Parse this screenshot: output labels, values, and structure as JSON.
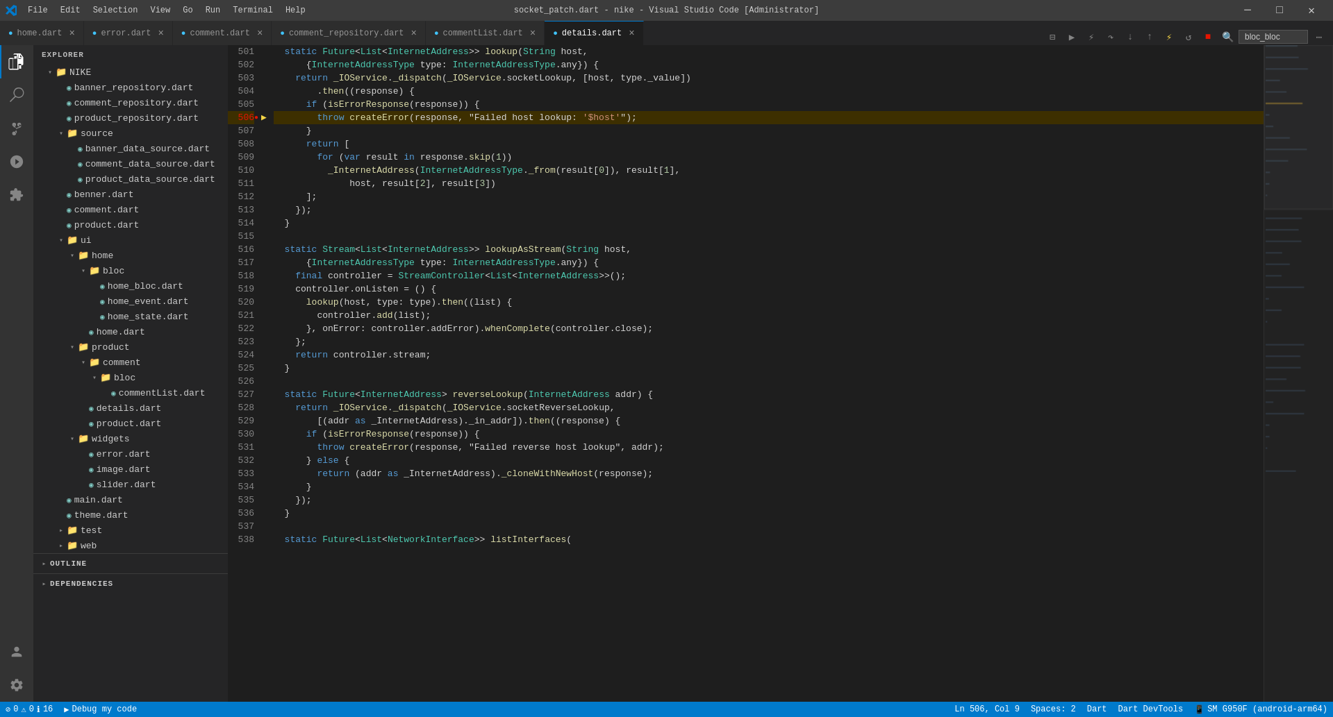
{
  "titlebar": {
    "title": "socket_patch.dart - nike - Visual Studio Code [Administrator]",
    "menu": [
      "File",
      "Edit",
      "Selection",
      "View",
      "Go",
      "Run",
      "Terminal",
      "Help"
    ],
    "controls": [
      "─",
      "□",
      "✕"
    ]
  },
  "tabs": [
    {
      "label": "home.dart",
      "icon": "dart",
      "active": false,
      "dirty": false
    },
    {
      "label": "error.dart",
      "icon": "dart",
      "active": false,
      "dirty": false
    },
    {
      "label": "comment.dart",
      "icon": "dart",
      "active": false,
      "dirty": false
    },
    {
      "label": "comment_repository.dart",
      "icon": "dart",
      "active": false,
      "dirty": false
    },
    {
      "label": "commentList.dart",
      "icon": "dart",
      "active": false,
      "dirty": false
    },
    {
      "label": "details.dart",
      "icon": "dart",
      "active": true,
      "dirty": false
    }
  ],
  "toolbar_search": "bloc_bloc",
  "sidebar": {
    "title": "EXPLORER",
    "tree": [
      {
        "label": "NIKE",
        "indent": 0,
        "type": "folder",
        "open": true
      },
      {
        "label": "banner_repository.dart",
        "indent": 1,
        "type": "file-dart"
      },
      {
        "label": "comment_repository.dart",
        "indent": 1,
        "type": "file-dart"
      },
      {
        "label": "product_repository.dart",
        "indent": 1,
        "type": "file-dart"
      },
      {
        "label": "source",
        "indent": 1,
        "type": "folder",
        "open": true
      },
      {
        "label": "banner_data_source.dart",
        "indent": 2,
        "type": "file-dart"
      },
      {
        "label": "comment_data_source.dart",
        "indent": 2,
        "type": "file-dart"
      },
      {
        "label": "product_data_source.dart",
        "indent": 2,
        "type": "file-dart"
      },
      {
        "label": "benner.dart",
        "indent": 1,
        "type": "file-dart"
      },
      {
        "label": "comment.dart",
        "indent": 1,
        "type": "file-dart"
      },
      {
        "label": "product.dart",
        "indent": 1,
        "type": "file-dart"
      },
      {
        "label": "ui",
        "indent": 1,
        "type": "folder",
        "open": true
      },
      {
        "label": "home",
        "indent": 2,
        "type": "folder",
        "open": true
      },
      {
        "label": "bloc",
        "indent": 3,
        "type": "folder",
        "open": true
      },
      {
        "label": "home_bloc.dart",
        "indent": 4,
        "type": "file-dart"
      },
      {
        "label": "home_event.dart",
        "indent": 4,
        "type": "file-dart"
      },
      {
        "label": "home_state.dart",
        "indent": 4,
        "type": "file-dart"
      },
      {
        "label": "home.dart",
        "indent": 3,
        "type": "file-dart"
      },
      {
        "label": "product",
        "indent": 2,
        "type": "folder",
        "open": true
      },
      {
        "label": "comment",
        "indent": 3,
        "type": "folder",
        "open": true
      },
      {
        "label": "bloc",
        "indent": 4,
        "type": "folder",
        "open": true
      },
      {
        "label": "commentList.dart",
        "indent": 5,
        "type": "file-dart"
      },
      {
        "label": "details.dart",
        "indent": 3,
        "type": "file-dart"
      },
      {
        "label": "product.dart",
        "indent": 3,
        "type": "file-dart"
      },
      {
        "label": "widgets",
        "indent": 2,
        "type": "folder",
        "open": true
      },
      {
        "label": "error.dart",
        "indent": 3,
        "type": "file-dart"
      },
      {
        "label": "image.dart",
        "indent": 3,
        "type": "file-dart"
      },
      {
        "label": "slider.dart",
        "indent": 3,
        "type": "file-dart"
      },
      {
        "label": "main.dart",
        "indent": 1,
        "type": "file-dart"
      },
      {
        "label": "theme.dart",
        "indent": 1,
        "type": "file-dart"
      },
      {
        "label": "test",
        "indent": 1,
        "type": "folder",
        "open": false
      },
      {
        "label": "web",
        "indent": 1,
        "type": "folder",
        "open": false
      }
    ],
    "outline": "OUTLINE",
    "dependencies": "DEPENDENCIES"
  },
  "code": {
    "lines": [
      {
        "num": 501,
        "content": "  static Future<List<InternetAddress>> lookup(String host,",
        "highlighted": false,
        "breakpoint": false
      },
      {
        "num": 502,
        "content": "      {InternetAddressType type: InternetAddressType.any}) {",
        "highlighted": false,
        "breakpoint": false
      },
      {
        "num": 503,
        "content": "    return _IOService._dispatch(_IOService.socketLookup, [host, type._value])",
        "highlighted": false,
        "breakpoint": false
      },
      {
        "num": 504,
        "content": "        .then((response) {",
        "highlighted": false,
        "breakpoint": false
      },
      {
        "num": 505,
        "content": "      if (isErrorResponse(response)) {",
        "highlighted": false,
        "breakpoint": false
      },
      {
        "num": 506,
        "content": "        throw createError(response, \"Failed host lookup: '$host'\");",
        "highlighted": true,
        "breakpoint": true,
        "debug": true
      },
      {
        "num": 507,
        "content": "      }",
        "highlighted": false,
        "breakpoint": false
      },
      {
        "num": 508,
        "content": "      return [",
        "highlighted": false,
        "breakpoint": false
      },
      {
        "num": 509,
        "content": "        for (var result in response.skip(1))",
        "highlighted": false,
        "breakpoint": false
      },
      {
        "num": 510,
        "content": "          _InternetAddress(InternetAddressType._from(result[0]), result[1],",
        "highlighted": false,
        "breakpoint": false
      },
      {
        "num": 511,
        "content": "              host, result[2], result[3])",
        "highlighted": false,
        "breakpoint": false
      },
      {
        "num": 512,
        "content": "      ];",
        "highlighted": false,
        "breakpoint": false
      },
      {
        "num": 513,
        "content": "    });",
        "highlighted": false,
        "breakpoint": false
      },
      {
        "num": 514,
        "content": "  }",
        "highlighted": false,
        "breakpoint": false
      },
      {
        "num": 515,
        "content": "",
        "highlighted": false,
        "breakpoint": false
      },
      {
        "num": 516,
        "content": "  static Stream<List<InternetAddress>> lookupAsStream(String host,",
        "highlighted": false,
        "breakpoint": false
      },
      {
        "num": 517,
        "content": "      {InternetAddressType type: InternetAddressType.any}) {",
        "highlighted": false,
        "breakpoint": false
      },
      {
        "num": 518,
        "content": "    final controller = StreamController<List<InternetAddress>>();",
        "highlighted": false,
        "breakpoint": false
      },
      {
        "num": 519,
        "content": "    controller.onListen = () {",
        "highlighted": false,
        "breakpoint": false
      },
      {
        "num": 520,
        "content": "      lookup(host, type: type).then((list) {",
        "highlighted": false,
        "breakpoint": false
      },
      {
        "num": 521,
        "content": "        controller.add(list);",
        "highlighted": false,
        "breakpoint": false
      },
      {
        "num": 522,
        "content": "      }, onError: controller.addError).whenComplete(controller.close);",
        "highlighted": false,
        "breakpoint": false
      },
      {
        "num": 523,
        "content": "    };",
        "highlighted": false,
        "breakpoint": false
      },
      {
        "num": 524,
        "content": "    return controller.stream;",
        "highlighted": false,
        "breakpoint": false
      },
      {
        "num": 525,
        "content": "  }",
        "highlighted": false,
        "breakpoint": false
      },
      {
        "num": 526,
        "content": "",
        "highlighted": false,
        "breakpoint": false
      },
      {
        "num": 527,
        "content": "  static Future<InternetAddress> reverseLookup(InternetAddress addr) {",
        "highlighted": false,
        "breakpoint": false
      },
      {
        "num": 528,
        "content": "    return _IOService._dispatch(_IOService.socketReverseLookup,",
        "highlighted": false,
        "breakpoint": false
      },
      {
        "num": 529,
        "content": "        [(addr as _InternetAddress)._in_addr]).then((response) {",
        "highlighted": false,
        "breakpoint": false
      },
      {
        "num": 530,
        "content": "      if (isErrorResponse(response)) {",
        "highlighted": false,
        "breakpoint": false
      },
      {
        "num": 531,
        "content": "        throw createError(response, \"Failed reverse host lookup\", addr);",
        "highlighted": false,
        "breakpoint": false
      },
      {
        "num": 532,
        "content": "      } else {",
        "highlighted": false,
        "breakpoint": false
      },
      {
        "num": 533,
        "content": "        return (addr as _InternetAddress)._cloneWithNewHost(response);",
        "highlighted": false,
        "breakpoint": false
      },
      {
        "num": 534,
        "content": "      }",
        "highlighted": false,
        "breakpoint": false
      },
      {
        "num": 535,
        "content": "    });",
        "highlighted": false,
        "breakpoint": false
      },
      {
        "num": 536,
        "content": "  }",
        "highlighted": false,
        "breakpoint": false
      },
      {
        "num": 537,
        "content": "",
        "highlighted": false,
        "breakpoint": false
      },
      {
        "num": 538,
        "content": "  static Future<List<NetworkInterface>> listInterfaces(",
        "highlighted": false,
        "breakpoint": false
      }
    ]
  },
  "statusbar": {
    "errors": "0",
    "warnings": "0",
    "info": "16",
    "debug": "Debug my code",
    "position": "Ln 506, Col 9",
    "spaces": "Spaces: 2",
    "encoding": "Dart",
    "tools": "Dart DevTools",
    "device": "SM G950F (android-arm64)"
  }
}
